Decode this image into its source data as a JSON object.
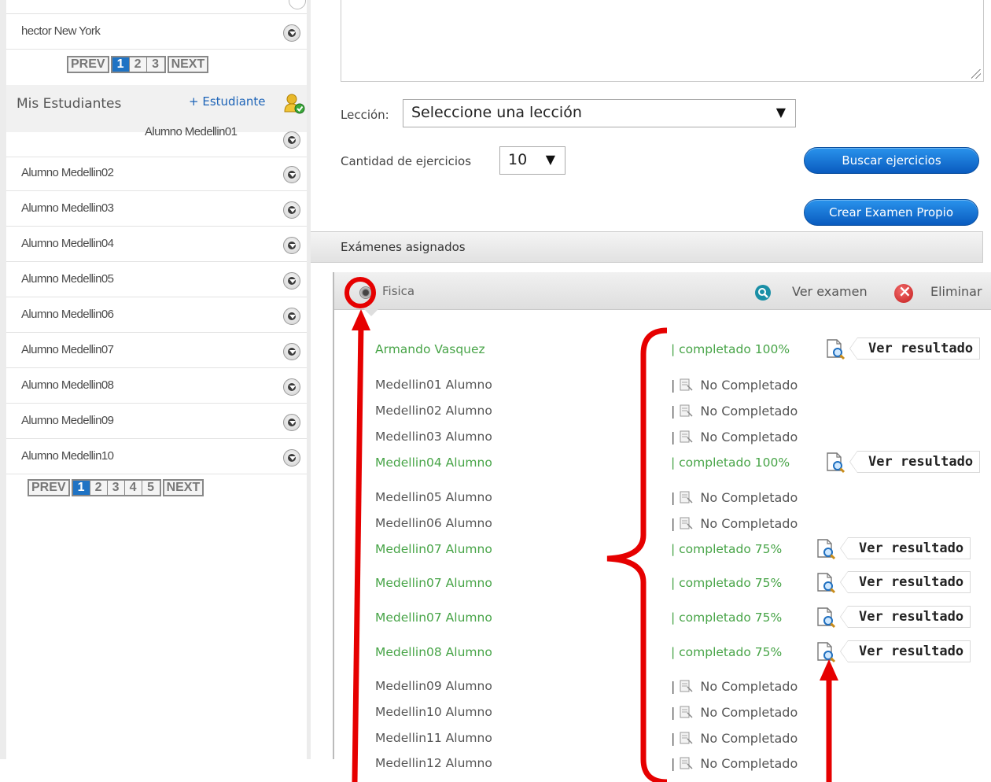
{
  "sidebar": {
    "top_student": "hector New York",
    "pager_top": {
      "prev": "PREV",
      "pages": [
        "1",
        "2",
        "3"
      ],
      "next": "NEXT"
    },
    "section_title": "Mis Estudiantes",
    "add_student": "+ Estudiante",
    "students": [
      "Alumno Medellin01",
      "Alumno Medellin02",
      "Alumno Medellin03",
      "Alumno Medellin04",
      "Alumno Medellin05",
      "Alumno Medellin06",
      "Alumno Medellin07",
      "Alumno Medellin08",
      "Alumno Medellin09",
      "Alumno Medellin10"
    ],
    "pager_bottom": {
      "prev": "PREV",
      "pages": [
        "1",
        "2",
        "3",
        "4",
        "5"
      ],
      "next": "NEXT"
    }
  },
  "form": {
    "leccion_label": "Lección:",
    "leccion_value": "Seleccione una lección",
    "cantidad_label": "Cantidad de ejercicios",
    "cantidad_value": "10",
    "dropdown_arrow": "▼",
    "buscar_button": "Buscar ejercicios",
    "crear_button": "Crear Examen Propio"
  },
  "exams": {
    "tab_label": "Exámenes asignados",
    "exam_name": "Fisica",
    "ver_examen": "Ver examen",
    "eliminar": "Eliminar",
    "result_button_label": "Ver resultado",
    "rows": [
      {
        "student": "Armando Vasquez",
        "status": "| completado 100%",
        "completed": true
      },
      {
        "student": "Medellin01 Alumno",
        "status": "No Completado",
        "completed": false
      },
      {
        "student": "Medellin02 Alumno",
        "status": "No Completado",
        "completed": false
      },
      {
        "student": "Medellin03 Alumno",
        "status": "No Completado",
        "completed": false
      },
      {
        "student": "Medellin04 Alumno",
        "status": "| completado 100%",
        "completed": true
      },
      {
        "student": "Medellin05 Alumno",
        "status": "No Completado",
        "completed": false
      },
      {
        "student": "Medellin06 Alumno",
        "status": "No Completado",
        "completed": false
      },
      {
        "student": "Medellin07 Alumno",
        "status": "| completado 75%",
        "completed": true
      },
      {
        "student": "Medellin07 Alumno",
        "status": "| completado 75%",
        "completed": true
      },
      {
        "student": "Medellin07 Alumno",
        "status": "| completado 75%",
        "completed": true
      },
      {
        "student": "Medellin08 Alumno",
        "status": "| completado 75%",
        "completed": true
      },
      {
        "student": "Medellin09 Alumno",
        "status": "No Completado",
        "completed": false
      },
      {
        "student": "Medellin10 Alumno",
        "status": "No Completado",
        "completed": false
      },
      {
        "student": "Medellin11 Alumno",
        "status": "No Completado",
        "completed": false
      },
      {
        "student": "Medellin12 Alumno",
        "status": "No Completado",
        "completed": false
      }
    ]
  },
  "colors": {
    "accent_blue": "#1f73c4",
    "completed_green": "#47a447",
    "annotation_red": "#e60000"
  }
}
